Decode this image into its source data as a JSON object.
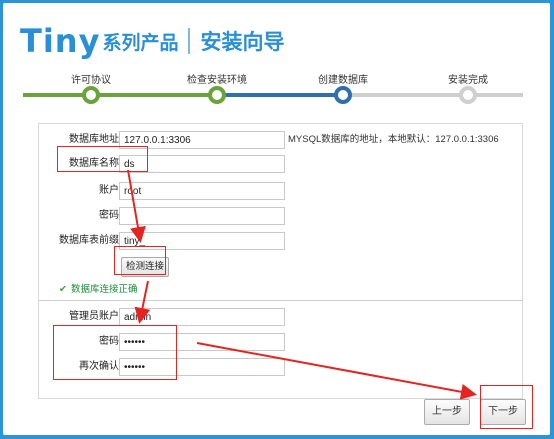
{
  "brand": {
    "tiny": "Tiny",
    "series": "系列产品",
    "guide": "安装向导"
  },
  "steps": [
    {
      "label": "许可协议",
      "state": "done"
    },
    {
      "label": "检查安装环境",
      "state": "done"
    },
    {
      "label": "创建数据库",
      "state": "current"
    },
    {
      "label": "安装完成",
      "state": "pending"
    }
  ],
  "colors": {
    "done": "#6aa33a",
    "current": "#2f6fae",
    "pending": "#cfcfcf",
    "annotation": "#e52421",
    "background": "#2b95d8"
  },
  "db_form": {
    "host": {
      "label": "数据库地址",
      "value": "127.0.0.1:3306",
      "hint": "MYSQL数据库的地址，本地默认：127.0.0.1:3306"
    },
    "name": {
      "label": "数据库名称",
      "value": "ds"
    },
    "user": {
      "label": "账户",
      "value": "root"
    },
    "password": {
      "label": "密码",
      "value": ""
    },
    "prefix": {
      "label": "数据库表前缀",
      "value": "tiny_"
    },
    "test_button": "检测连接",
    "status": "数据库连接正确"
  },
  "admin_form": {
    "account": {
      "label": "管理员账户",
      "value": "admin"
    },
    "password": {
      "label": "密码",
      "value": "••••••"
    },
    "confirm": {
      "label": "再次确认",
      "value": "••••••"
    }
  },
  "nav": {
    "prev": "上一步",
    "next": "下一步"
  }
}
